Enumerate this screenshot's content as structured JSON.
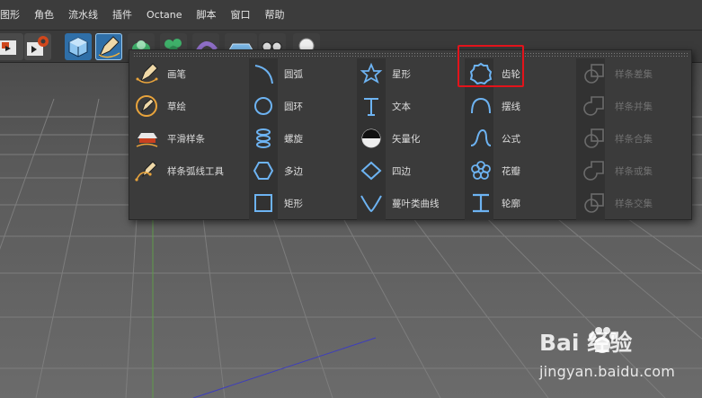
{
  "menubar": {
    "items": [
      "图形",
      "角色",
      "流水线",
      "插件",
      "Octane",
      "脚本",
      "窗口",
      "帮助"
    ]
  },
  "dropdown": {
    "columns": [
      {
        "items": [
          {
            "label": "画笔",
            "icon": "pen-icon",
            "enabled": true
          },
          {
            "label": "草绘",
            "icon": "sketch-icon",
            "enabled": true
          },
          {
            "label": "平滑样条",
            "icon": "smooth-spline-icon",
            "enabled": true
          },
          {
            "label": "样条弧线工具",
            "icon": "spline-arc-tool-icon",
            "enabled": true
          }
        ]
      },
      {
        "items": [
          {
            "label": "圆弧",
            "icon": "arc-icon",
            "enabled": true
          },
          {
            "label": "圆环",
            "icon": "circle-icon",
            "enabled": true
          },
          {
            "label": "螺旋",
            "icon": "helix-icon",
            "enabled": true
          },
          {
            "label": "多边",
            "icon": "polygon-icon",
            "enabled": true
          },
          {
            "label": "矩形",
            "icon": "rectangle-icon",
            "enabled": true
          }
        ]
      },
      {
        "items": [
          {
            "label": "星形",
            "icon": "star-icon",
            "enabled": true
          },
          {
            "label": "文本",
            "icon": "text-icon",
            "enabled": true
          },
          {
            "label": "矢量化",
            "icon": "vectorize-icon",
            "enabled": true
          },
          {
            "label": "四边",
            "icon": "diamond-icon",
            "enabled": true
          },
          {
            "label": "蔓叶类曲线",
            "icon": "cissoid-icon",
            "enabled": true
          }
        ]
      },
      {
        "items": [
          {
            "label": "齿轮",
            "icon": "gear-icon",
            "enabled": true
          },
          {
            "label": "摆线",
            "icon": "cycloid-icon",
            "enabled": true
          },
          {
            "label": "公式",
            "icon": "formula-icon",
            "enabled": true
          },
          {
            "label": "花瓣",
            "icon": "flower-icon",
            "enabled": true
          },
          {
            "label": "轮廓",
            "icon": "profile-icon",
            "enabled": true
          }
        ]
      },
      {
        "items": [
          {
            "label": "样条差集",
            "icon": "spline-subtract-icon",
            "enabled": false
          },
          {
            "label": "样条并集",
            "icon": "spline-union-icon",
            "enabled": false
          },
          {
            "label": "样条合集",
            "icon": "spline-and-icon",
            "enabled": false
          },
          {
            "label": "样条或集",
            "icon": "spline-or-icon",
            "enabled": false
          },
          {
            "label": "样条交集",
            "icon": "spline-intersect-icon",
            "enabled": false
          }
        ]
      }
    ]
  },
  "highlight_color": "#e3131b",
  "accent_color": "#6db3f2",
  "watermark": {
    "brand": "Bai  经验",
    "url": "jingyan.baidu.com"
  }
}
